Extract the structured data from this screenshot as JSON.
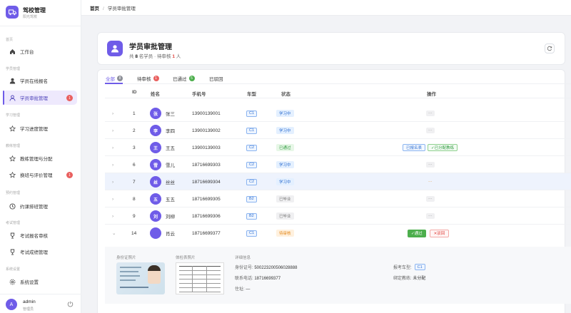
{
  "app": {
    "name": "驾校管理",
    "subtitle": "阳光驾校"
  },
  "sidebar": {
    "groups": [
      "首页",
      "学员管理",
      "学习管理",
      "教练管理",
      "预约管理",
      "考试管理",
      "系统设置"
    ],
    "items": [
      {
        "label": "工作台"
      },
      {
        "label": "学员在线报名"
      },
      {
        "label": "学员审批管理",
        "badge": "1"
      },
      {
        "label": "学习进度管理"
      },
      {
        "label": "教练管理与分配"
      },
      {
        "label": "换班与评价管理",
        "badge": "1"
      },
      {
        "label": "约课排班管理"
      },
      {
        "label": "考试报名审核"
      },
      {
        "label": "考试成绩管理"
      },
      {
        "label": "系统设置"
      }
    ],
    "user": {
      "avatar": "A",
      "name": "admin",
      "role": "管理员"
    }
  },
  "breadcrumb": {
    "home": "首页",
    "sep": "/",
    "current": "学员审批管理"
  },
  "header": {
    "title": "学员审批管理",
    "total_pre": "共",
    "total": "8",
    "total_mid": "名学员 · 待审核",
    "pending": "1",
    "total_post": "人"
  },
  "tabs": [
    {
      "label": "全部",
      "count": "8",
      "color": "#8b8e96"
    },
    {
      "label": "待审核",
      "count": "1",
      "color": "#e9605f"
    },
    {
      "label": "已通过",
      "count": "5",
      "color": "#4cae4c"
    },
    {
      "label": "已驳回",
      "count": ""
    }
  ],
  "table": {
    "headers": {
      "id": "ID",
      "name": "姓名",
      "phone": "手机号",
      "car": "车型",
      "status": "状态",
      "ops": "操作"
    },
    "rows": [
      {
        "id": "1",
        "av": "张",
        "name": "张三",
        "phone": "13900139001",
        "car": "C1",
        "status": "学习中",
        "op": "···"
      },
      {
        "id": "2",
        "av": "李",
        "name": "李四",
        "phone": "13900139002",
        "car": "C1",
        "status": "学习中",
        "op": "···"
      },
      {
        "id": "3",
        "av": "王",
        "name": "王五",
        "phone": "13900139003",
        "car": "C2",
        "status": "已通过",
        "op": "已报名表",
        "op2": "✓已分配教练"
      },
      {
        "id": "6",
        "av": "雪",
        "name": "雪儿",
        "phone": "18716699303",
        "car": "C2",
        "status": "学习中",
        "op": "···"
      },
      {
        "id": "7",
        "av": "丝",
        "name": "丝丝",
        "phone": "18716699304",
        "car": "C2",
        "status": "学习中",
        "op": "···"
      },
      {
        "id": "8",
        "av": "五",
        "name": "五五",
        "phone": "18716699305",
        "car": "B2",
        "status": "已毕业",
        "op": "···"
      },
      {
        "id": "9",
        "av": "刘",
        "name": "刘柳",
        "phone": "18716699306",
        "car": "B2",
        "status": "已毕业",
        "op": "···"
      },
      {
        "id": "14",
        "av": "",
        "name": "肖云",
        "phone": "18716699377",
        "car": "C1",
        "status": "待审核",
        "approve": "✓通过",
        "reject": "✕驳回"
      }
    ]
  },
  "detail": {
    "id_photo_label": "身份证照片",
    "health_label": "体检表照片",
    "info_label": "详细信息",
    "id_no_label": "身份证号:",
    "id_no": "500223200506028888",
    "phone_label": "联系电话:",
    "phone": "18716699377",
    "address_label": "住址:",
    "address": "—",
    "car_label": "报考车型:",
    "car": "C1",
    "coach_label": "绑定教练:",
    "coach": "未分配"
  },
  "colors": {
    "accent": "#6f5ce8",
    "danger": "#e0443e",
    "success": "#4cae4c"
  }
}
